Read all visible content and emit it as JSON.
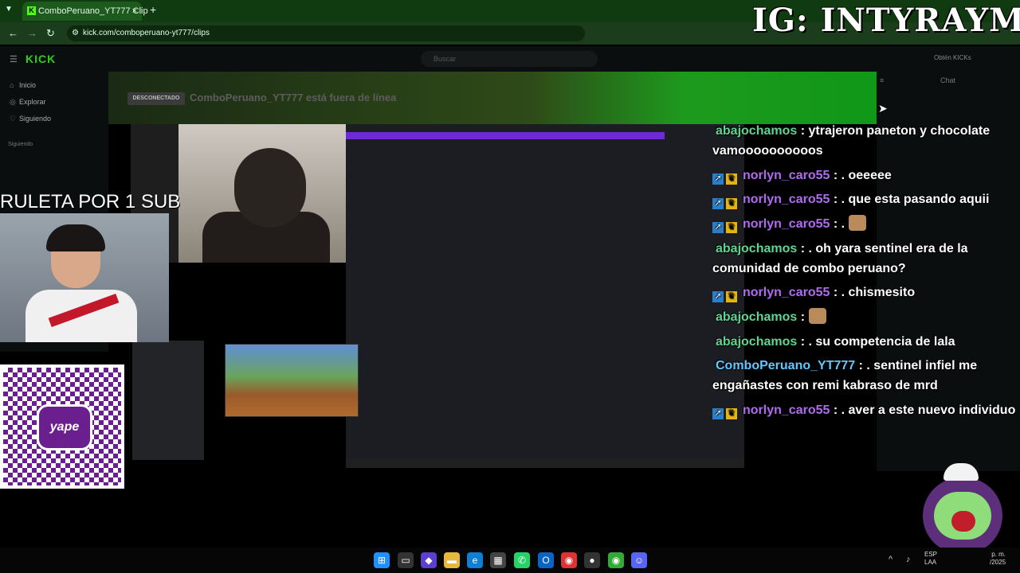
{
  "browser": {
    "tab_title": "ComboPeruano_YT777 Clip",
    "url": "kick.com/comboperuano-yt777/clips",
    "new_tab_icon": "plus-icon"
  },
  "overlay": {
    "instagram": "IG: INTYRAYMI",
    "ruleta": "RULETA POR 1 SUB"
  },
  "kick": {
    "logo": "KICK",
    "search_placeholder": "Buscar",
    "kicks_button": "Obtén KICKs",
    "nav": [
      {
        "label": "Inicio",
        "icon": "home-icon"
      },
      {
        "label": "Explorar",
        "icon": "compass-icon"
      },
      {
        "label": "Siguiendo",
        "icon": "heart-icon"
      }
    ],
    "following_header": "Siguiendo",
    "offline_badge": "DESCONECTADO",
    "offline_text": "ComboPeruano_YT777 está fuera de línea",
    "chat_header": "Chat"
  },
  "qr": {
    "brand": "yape"
  },
  "chat": {
    "messages": [
      {
        "user": "abajochamos",
        "text": ": ytrajeron paneton y chocolate vamoooooooooos",
        "color": "green",
        "badges": false
      },
      {
        "user": "norlyn_caro55",
        "text": ": . oeeeee",
        "color": "purple",
        "badges": true
      },
      {
        "user": "norlyn_caro55",
        "text": ": . que esta pasando aquii",
        "color": "purple",
        "badges": true
      },
      {
        "user": "norlyn_caro55",
        "text": ": .",
        "color": "purple",
        "badges": true,
        "emote": true
      },
      {
        "user": "abajochamos",
        "text": ": . oh yara sentinel era de la comunidad de combo peruano?",
        "color": "green",
        "badges": false
      },
      {
        "user": "norlyn_caro55",
        "text": ": . chismesito",
        "color": "purple",
        "badges": true
      },
      {
        "user": "abajochamos",
        "text": ":",
        "color": "green",
        "badges": false,
        "emote": true
      },
      {
        "user": "abajochamos",
        "text": ": . su competencia de lala",
        "color": "green",
        "badges": false
      },
      {
        "user": "ComboPeruano_YT777",
        "text": ": . sentinel infiel me engañastes con remi kabraso de mrd",
        "color": "blue",
        "badges": false
      },
      {
        "user": "norlyn_caro55",
        "text": ": . aver a este nuevo individuo",
        "color": "purple",
        "badges": true
      }
    ]
  },
  "taskbar": {
    "tray_lang": "ESP",
    "tray_region": "LAA",
    "clock_time": "p. m.",
    "clock_date": "/2025"
  }
}
